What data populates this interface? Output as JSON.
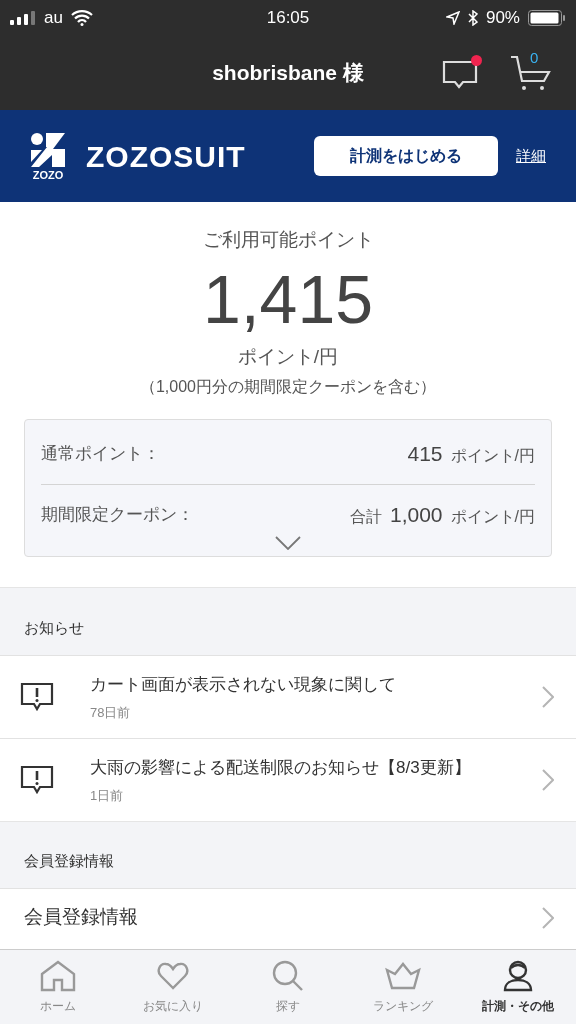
{
  "status_bar": {
    "carrier": "au",
    "time": "16:05",
    "battery": "90%"
  },
  "header": {
    "title": "shobrisbane 様",
    "messages_unread": true,
    "cart_count": "0"
  },
  "banner": {
    "logo_small": "ZOZO",
    "logo": "ZOZOSUIT",
    "button": "計測をはじめる",
    "link": "詳細"
  },
  "points": {
    "label": "ご利用可能ポイント",
    "value": "1,415",
    "unit": "ポイント/円",
    "note": "（1,000円分の期間限定クーポンを含む）",
    "rows": [
      {
        "label": "通常ポイント：",
        "prefix": "",
        "value": "415",
        "unit": "ポイント/円"
      },
      {
        "label": "期間限定クーポン：",
        "prefix": "合計",
        "value": "1,000",
        "unit": "ポイント/円"
      }
    ]
  },
  "news": {
    "title": "お知らせ",
    "items": [
      {
        "title": "カート画面が表示されない現象に関して",
        "date": "78日前"
      },
      {
        "title": "大雨の影響による配送制限のお知らせ【8/3更新】",
        "date": "1日前"
      }
    ]
  },
  "member": {
    "title": "会員登録情報",
    "items": [
      "会員登録情報"
    ]
  },
  "tabs": [
    {
      "kind": "home",
      "label": "ホーム",
      "selected": false
    },
    {
      "kind": "heart",
      "label": "お気に入り",
      "selected": false
    },
    {
      "kind": "search",
      "label": "探す",
      "selected": false
    },
    {
      "kind": "crown",
      "label": "ランキング",
      "selected": false
    },
    {
      "kind": "person",
      "label": "計測・その他",
      "selected": true
    }
  ]
}
